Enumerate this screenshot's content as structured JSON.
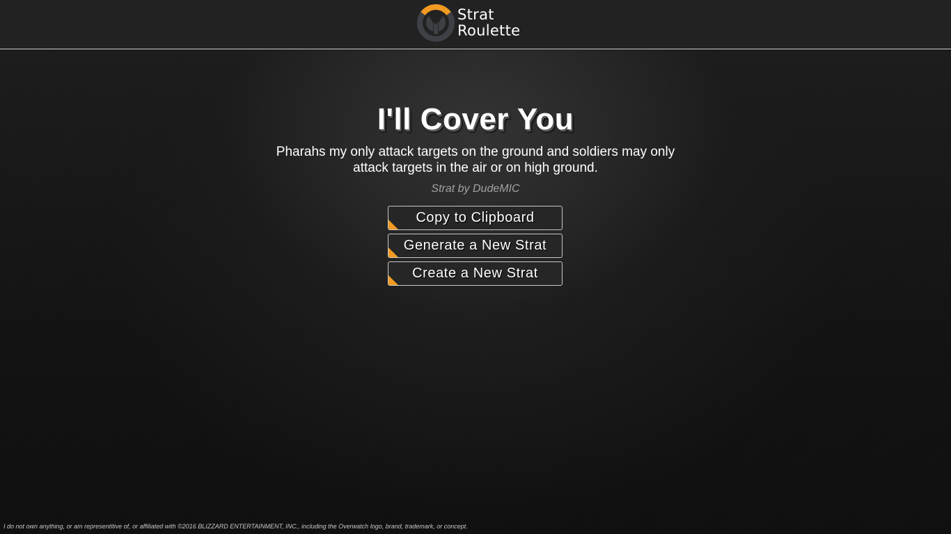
{
  "header": {
    "logo_line1": "Strat",
    "logo_line2": "Roulette",
    "logo_icon": "overwatch-logo-icon",
    "accent_color": "#f29a21"
  },
  "strat": {
    "title": "I'll Cover You",
    "description": "Pharahs my only attack targets on the ground and soldiers may only attack targets in the air or on high ground.",
    "author": "Strat by DudeMIC"
  },
  "buttons": {
    "copy": "Copy to Clipboard",
    "generate": "Generate a New Strat",
    "create": "Create a New Strat"
  },
  "footer": {
    "disclaimer": "I do not own anything, or am representitive of, or affiliated with ©2016 BLIZZARD ENTERTAINMENT, INC., including the Overwatch logo, brand, trademark, or concept."
  }
}
